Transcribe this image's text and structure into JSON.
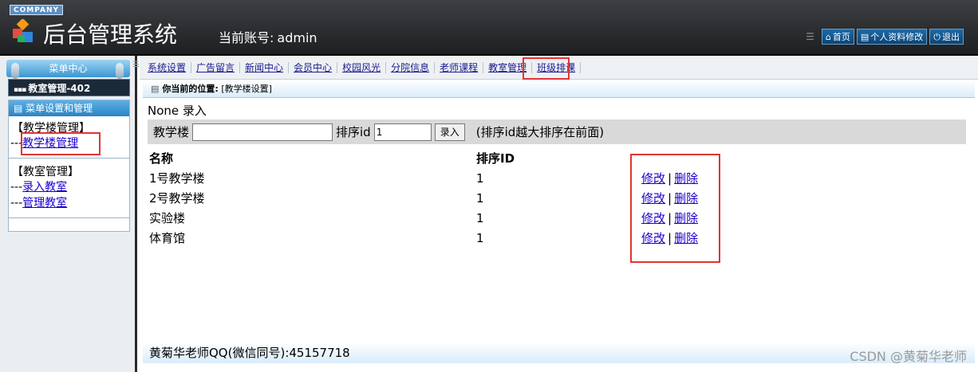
{
  "header": {
    "company_badge": "COMPANY",
    "title": "后台管理系统",
    "account_label": "当前账号:",
    "account_value": "admin",
    "actions": [
      "首页",
      "个人资料修改",
      "退出"
    ]
  },
  "sidebar": {
    "menu_center": "菜单中心",
    "module": "教室管理-402",
    "panel_title": "菜单设置和管理",
    "groups": [
      {
        "title": "【教学楼管理】",
        "links": [
          "教学楼管理"
        ]
      },
      {
        "title": "【教室管理】",
        "links": [
          "录入教室",
          "管理教室"
        ]
      }
    ],
    "link_prefix": "---"
  },
  "nav": {
    "items": [
      "系统设置",
      "广告留言",
      "新闻中心",
      "会员中心",
      "校园风光",
      "分院信息",
      "老师课程",
      "教室管理",
      "班级排课"
    ],
    "active_index": 7
  },
  "main": {
    "breadcrumb_label": "你当前的位置:",
    "breadcrumb_value": "[教学楼设置]",
    "record_title": "None 录入",
    "form": {
      "name_label": "教学楼",
      "name_value": "",
      "sort_label": "排序id",
      "sort_value": "1",
      "submit_label": "录入",
      "hint": "(排序id越大排序在前面)"
    },
    "table": {
      "headers": [
        "名称",
        "排序ID"
      ],
      "rows": [
        {
          "name": "1号教学楼",
          "sort": "1"
        },
        {
          "name": "2号教学楼",
          "sort": "1"
        },
        {
          "name": "实验楼",
          "sort": "1"
        },
        {
          "name": "体育馆",
          "sort": "1"
        }
      ],
      "edit_label": "修改",
      "delete_label": "删除",
      "separator": "|"
    },
    "footer": "黄菊华老师QQ(微信同号):45157718"
  },
  "watermark": "CSDN @黄菊华老师",
  "colors": {
    "highlight_box": "#e03535",
    "link": "#1a00cc",
    "header_bg": "#2a2c2f",
    "menu_blue": "#3a96d2"
  }
}
